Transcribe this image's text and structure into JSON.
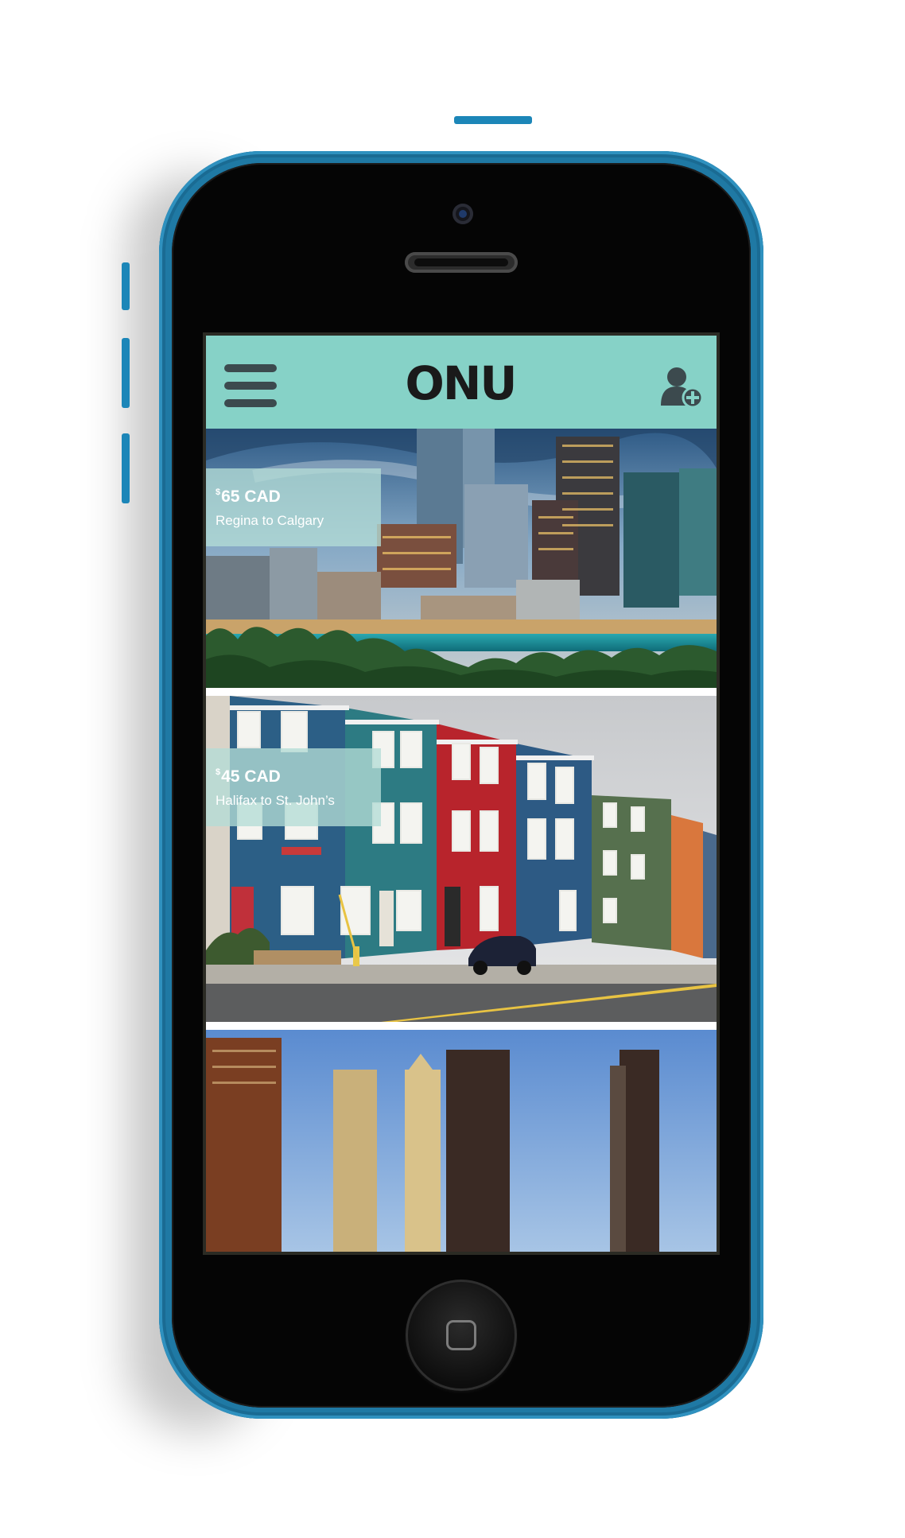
{
  "app": {
    "logo_text": "ONU",
    "header_color": "#86d2c7",
    "menu_icon": "hamburger-menu-icon",
    "add_user_icon": "add-user-icon"
  },
  "trips": [
    {
      "currency_symbol": "$",
      "price": "65 CAD",
      "route": "Regina to Calgary",
      "image": "calgary-skyline-dusk"
    },
    {
      "currency_symbol": "$",
      "price": "45 CAD",
      "route": "Halifax to St. John’s",
      "image": "st-johns-colorful-row-houses"
    },
    {
      "image": "city-skyline-partial"
    }
  ],
  "device": {
    "color": "#1f79a4",
    "home_button_icon": "home-square-icon"
  }
}
